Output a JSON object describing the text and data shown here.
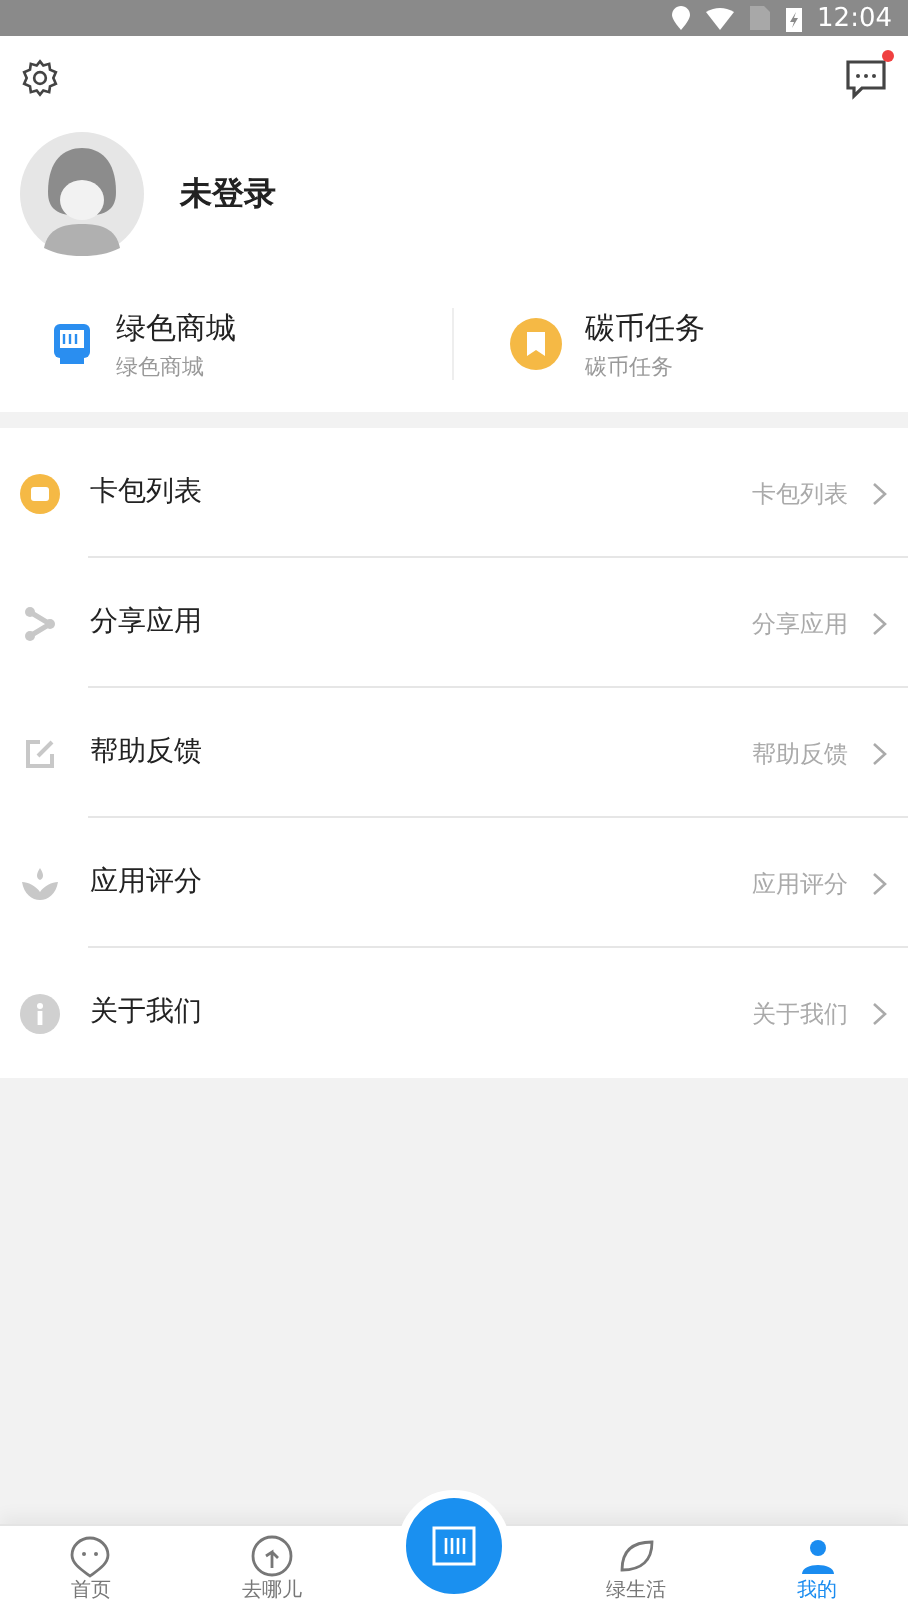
{
  "status_bar": {
    "time": "12:04"
  },
  "profile": {
    "name": "未登录"
  },
  "message_badge": {
    "on": true
  },
  "shortcuts": [
    {
      "kind": "mall",
      "title": "绿色商城",
      "subtitle": "绿色商城"
    },
    {
      "kind": "coin",
      "title": "碳币任务",
      "subtitle": "碳币任务"
    }
  ],
  "menu": [
    {
      "kind": "card",
      "label": "卡包列表",
      "value": "卡包列表"
    },
    {
      "kind": "share",
      "label": "分享应用",
      "value": "分享应用"
    },
    {
      "kind": "feedback",
      "label": "帮助反馈",
      "value": "帮助反馈"
    },
    {
      "kind": "rate",
      "label": "应用评分",
      "value": "应用评分"
    },
    {
      "kind": "about",
      "label": "关于我们",
      "value": "关于我们"
    }
  ],
  "tab_bar": [
    {
      "kind": "home",
      "label": "首页",
      "selected": false
    },
    {
      "kind": "route",
      "label": "去哪儿",
      "selected": false
    },
    {
      "kind": "scan",
      "selected": false
    },
    {
      "kind": "life",
      "label": "绿生活",
      "selected": false
    },
    {
      "kind": "me",
      "label": "我的",
      "selected": true
    }
  ]
}
